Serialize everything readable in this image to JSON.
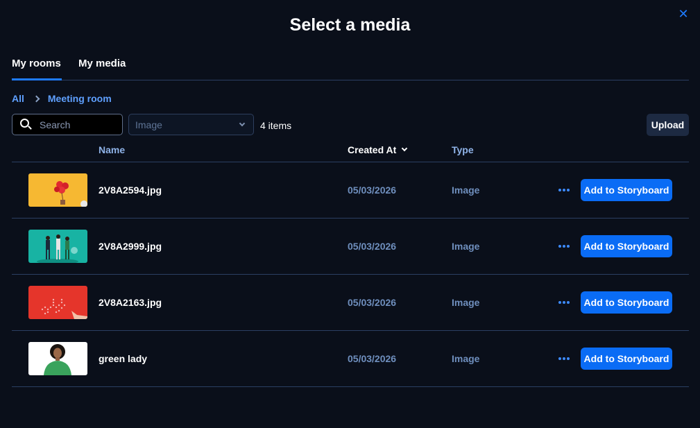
{
  "modal": {
    "title": "Select a media",
    "close_icon": "close-icon"
  },
  "tabs": [
    {
      "label": "My rooms",
      "active": true
    },
    {
      "label": "My media",
      "active": false
    }
  ],
  "breadcrumb": [
    {
      "label": "All"
    },
    {
      "label": "Meeting room"
    }
  ],
  "toolbar": {
    "search_placeholder": "Search",
    "type_filter_placeholder": "Image",
    "item_count": "4 items",
    "upload_label": "Upload"
  },
  "table": {
    "columns": {
      "name": "Name",
      "created_at": "Created At",
      "type": "Type"
    },
    "rows": [
      {
        "name": "2V8A2594.jpg",
        "created_at": "05/03/2026",
        "type": "Image",
        "action": "Add to Storyboard"
      },
      {
        "name": "2V8A2999.jpg",
        "created_at": "05/03/2026",
        "type": "Image",
        "action": "Add to Storyboard"
      },
      {
        "name": "2V8A2163.jpg",
        "created_at": "05/03/2026",
        "type": "Image",
        "action": "Add to Storyboard"
      },
      {
        "name": "green lady",
        "created_at": "05/03/2026",
        "type": "Image",
        "action": "Add to Storyboard"
      }
    ]
  },
  "colors": {
    "background": "#0a0f1a",
    "accent": "#1f7bff",
    "primary_button": "#0a6cf5",
    "divider": "#2b3f63",
    "muted_text": "#6f8fbe"
  }
}
